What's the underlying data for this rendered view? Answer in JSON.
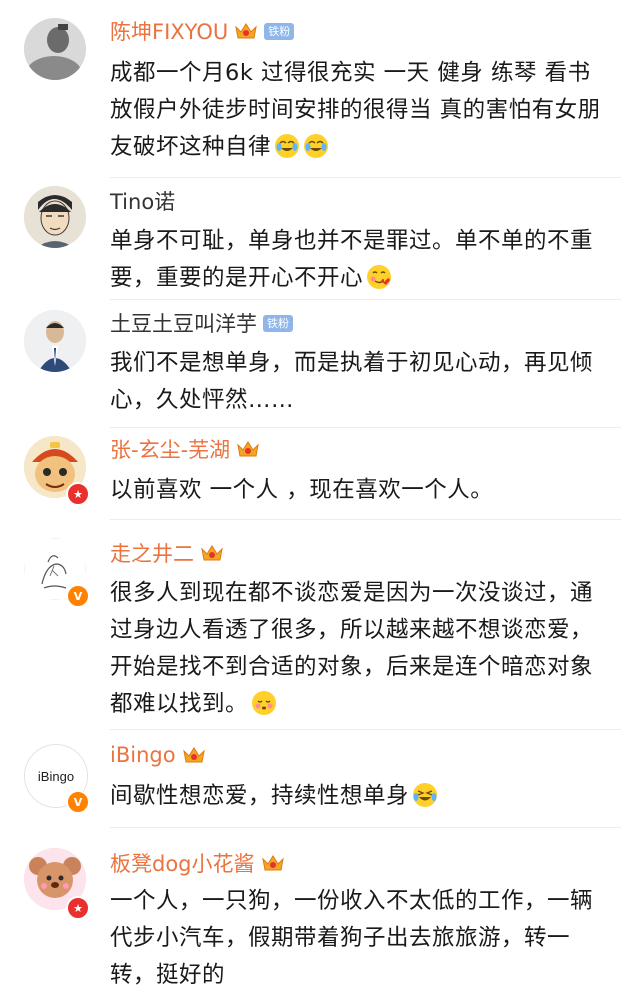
{
  "comments": [
    {
      "name": "陈坤FIXYOU",
      "badge": "铁粉",
      "text": "成都一个月6k 过得很充实 一天 健身 练琴 看书 放假户外徒步时间安排的很得当 真的害怕有女朋友破坏这种自律",
      "emojis": [
        "crying-laughing-emoji",
        "crying-laughing-emoji"
      ]
    },
    {
      "name": "Tino诺",
      "text": "单身不可耻，单身也并不是罪过。单不单的不重要，重要的是开心不开心",
      "emojis": [
        "love-face-emoji"
      ]
    },
    {
      "name": "土豆土豆叫洋芋",
      "badge": "铁粉",
      "text": "我们不是想单身，而是执着于初见心动，再见倾心，久处怦然……"
    },
    {
      "name": "张-玄尘-芜湖",
      "text": "以前喜欢 一个人 ，现在喜欢一个人。"
    },
    {
      "name": "走之井二",
      "text": "很多人到现在都不谈恋爱是因为一次没谈过，通过身边人看透了很多，所以越来越不想谈恋爱，开始是找不到合适的对象，后来是连个暗恋对象都难以找到。",
      "emojis": [
        "blush-face-emoji"
      ]
    },
    {
      "name": "iBingo",
      "avatar_text": "iBingo",
      "text": "间歇性想恋爱，持续性想单身",
      "emojis": [
        "laughing-tears-emoji"
      ]
    },
    {
      "name": "板凳dog小花酱",
      "text": "一个人，一只狗，一份收入不太低的工作，一辆代步小汽车，假期带着狗子出去旅旅游，转一转，挺好的"
    }
  ],
  "colors": {
    "vip_name": "#eb7340",
    "plain_name": "#333333",
    "fan_badge": "#8fb6e8",
    "verified_orange": "#ff8200",
    "verified_red": "#e8312f"
  }
}
